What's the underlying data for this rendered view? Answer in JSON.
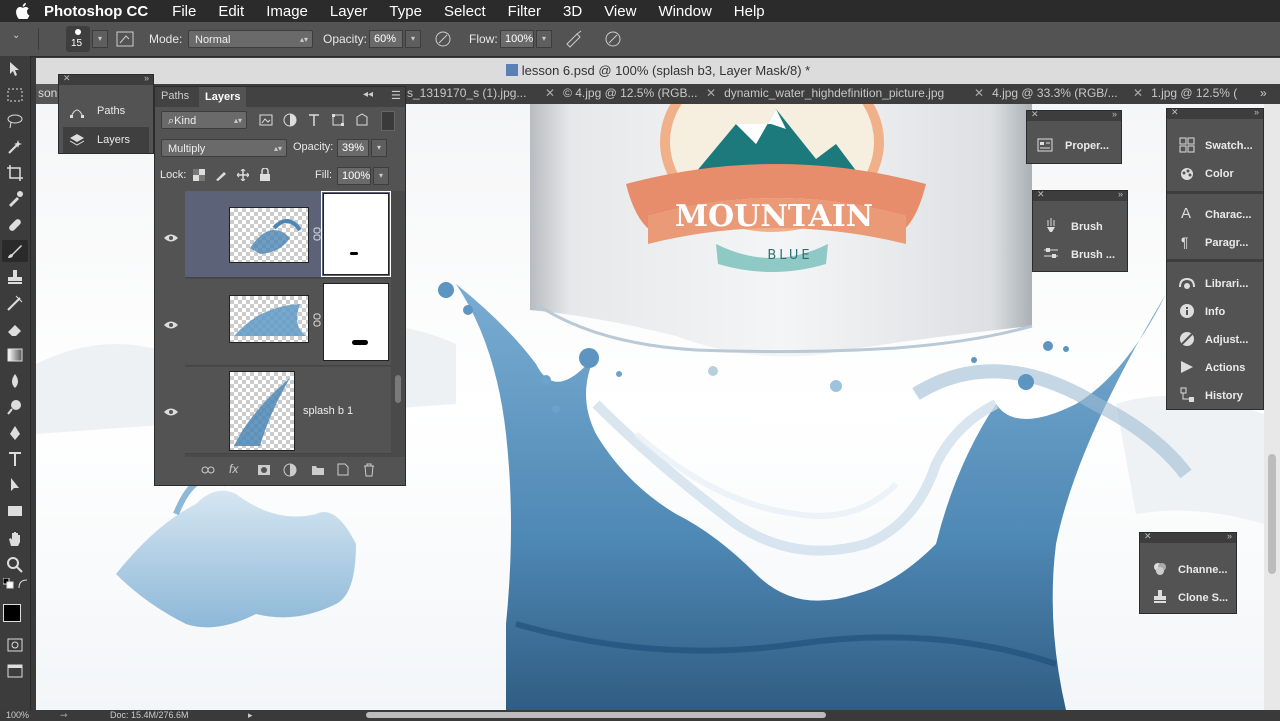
{
  "menubar": {
    "app_name": "Photoshop CC",
    "items": [
      "File",
      "Edit",
      "Image",
      "Layer",
      "Type",
      "Select",
      "Filter",
      "3D",
      "View",
      "Window",
      "Help"
    ]
  },
  "options": {
    "brush_size": "15",
    "mode_label": "Mode:",
    "mode_value": "Normal",
    "opacity_label": "Opacity:",
    "opacity_value": "60%",
    "flow_label": "Flow:",
    "flow_value": "100%"
  },
  "document": {
    "title": "lesson 6.psd @ 100% (splash b3, Layer Mask/8) *",
    "left_tab_fragment": "son",
    "tabs": [
      "s_1319170_s (1).jpg...",
      "© 4.jpg @ 12.5% (RGB...",
      "dynamic_water_highdefinition_picture.jpg",
      "4.jpg @ 33.3% (RGB/...",
      "1.jpg @ 12.5% (",
      ""
    ]
  },
  "artwork": {
    "logo_top": "MOUNTAIN",
    "logo_bottom": "BLUE"
  },
  "mini_panel": {
    "items": [
      {
        "label": "Paths",
        "icon": "paths-icon"
      },
      {
        "label": "Layers",
        "icon": "layers-icon"
      }
    ]
  },
  "layers_panel": {
    "tabs": [
      "Paths",
      "Layers"
    ],
    "kind_label": "Kind",
    "blend_mode": "Multiply",
    "opacity_label": "Opacity:",
    "opacity_value": "39%",
    "lock_label": "Lock:",
    "fill_label": "Fill:",
    "fill_value": "100%",
    "layers": [
      {
        "name": "",
        "selected": true,
        "has_mask": true
      },
      {
        "name": "",
        "selected": false,
        "has_mask": true
      },
      {
        "name": "splash b 1",
        "selected": false,
        "has_mask": false
      }
    ]
  },
  "properties_panel": {
    "label": "Proper..."
  },
  "brush_panel": {
    "items": [
      "Brush",
      "Brush ..."
    ]
  },
  "right_panel": {
    "groups": [
      [
        "Swatch...",
        "Color"
      ],
      [
        "Charac...",
        "Paragr..."
      ],
      [
        "Librari...",
        "Info",
        "Adjust...",
        "Actions",
        "History"
      ]
    ]
  },
  "channels_panel": {
    "items": [
      "Channe...",
      "Clone S..."
    ]
  },
  "status": {
    "doc_info": "Doc: 15.4M/276.6M",
    "zoom": "100%"
  }
}
